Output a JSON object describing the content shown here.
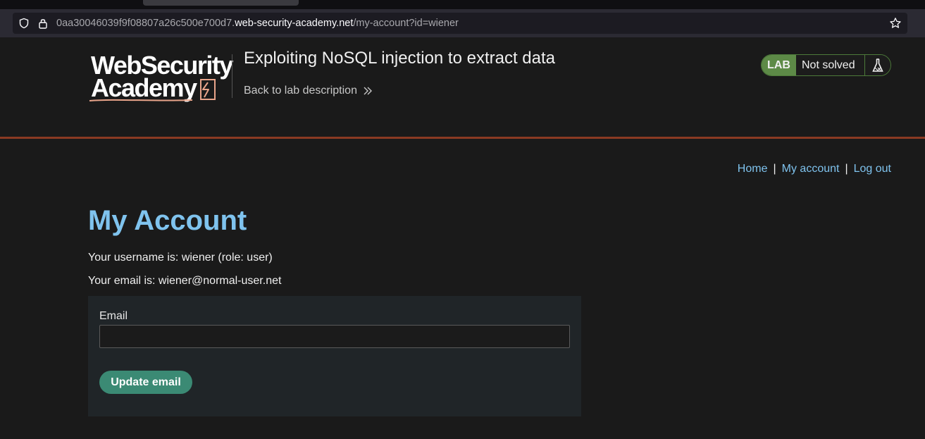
{
  "browser": {
    "url_prefix": "0aa30046039f9f08807a26c500e700d7.",
    "url_host": "web-security-academy.net",
    "url_path": "/my-account?id=wiener"
  },
  "header": {
    "logo_line1": "WebSecurity",
    "logo_line2": "Academy",
    "lab_title": "Exploiting NoSQL injection to extract data",
    "back_link": "Back to lab description",
    "lab_tag": "LAB",
    "lab_state": "Not solved"
  },
  "nav": {
    "home": "Home",
    "my_account": "My account",
    "log_out": "Log out",
    "separator": "|"
  },
  "account": {
    "title": "My Account",
    "username_line": "Your username is: wiener (role: user)",
    "email_line": "Your email is: wiener@normal-user.net",
    "email_label": "Email",
    "email_value": "",
    "update_button": "Update email"
  },
  "colors": {
    "accent_link": "#7fc3ee",
    "header_border": "#8a3a22",
    "lab_green": "#5d8a47",
    "button_teal": "#3b8a74"
  }
}
